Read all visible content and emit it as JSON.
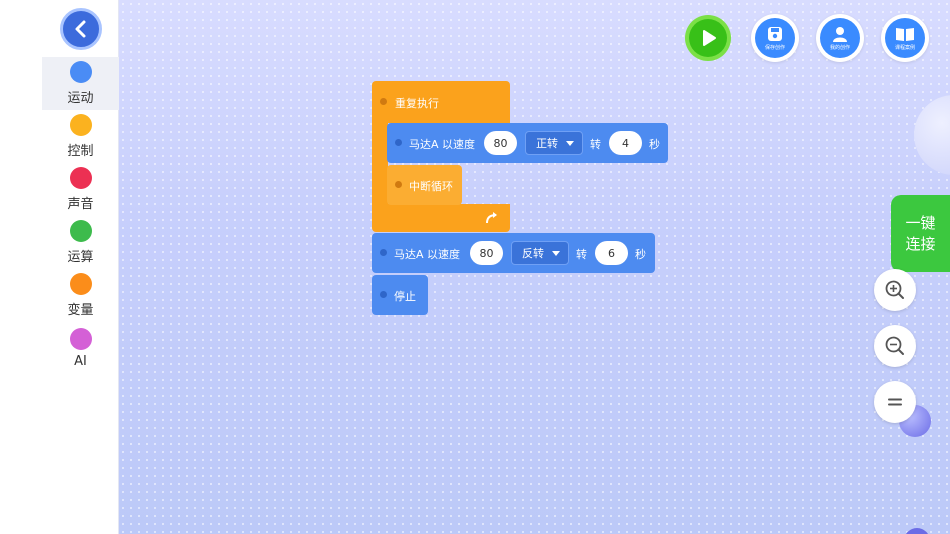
{
  "sidebar": {
    "categories": [
      {
        "label": "运动",
        "color": "#4a8cf5"
      },
      {
        "label": "控制",
        "color": "#fbb21f"
      },
      {
        "label": "声音",
        "color": "#ec3053"
      },
      {
        "label": "运算",
        "color": "#3dbb4c"
      },
      {
        "label": "变量",
        "color": "#fb8d1a"
      },
      {
        "label": "AI",
        "color": "#d460d6"
      }
    ]
  },
  "toolbar": {
    "save": "保存创作",
    "my_works": "我的创作",
    "course_cases": "课程案例"
  },
  "connect": {
    "line1": "一键",
    "line2": "连接"
  },
  "blocks": {
    "repeat": "重复执行",
    "motor1": {
      "label": "马达A 以速度",
      "speed": "80",
      "direction": "正转",
      "turn": "转",
      "seconds": "4",
      "unit": "秒"
    },
    "break": "中断循环",
    "motor2": {
      "label": "马达A 以速度",
      "speed": "80",
      "direction": "反转",
      "turn": "转",
      "seconds": "6",
      "unit": "秒"
    },
    "stop": "停止"
  }
}
